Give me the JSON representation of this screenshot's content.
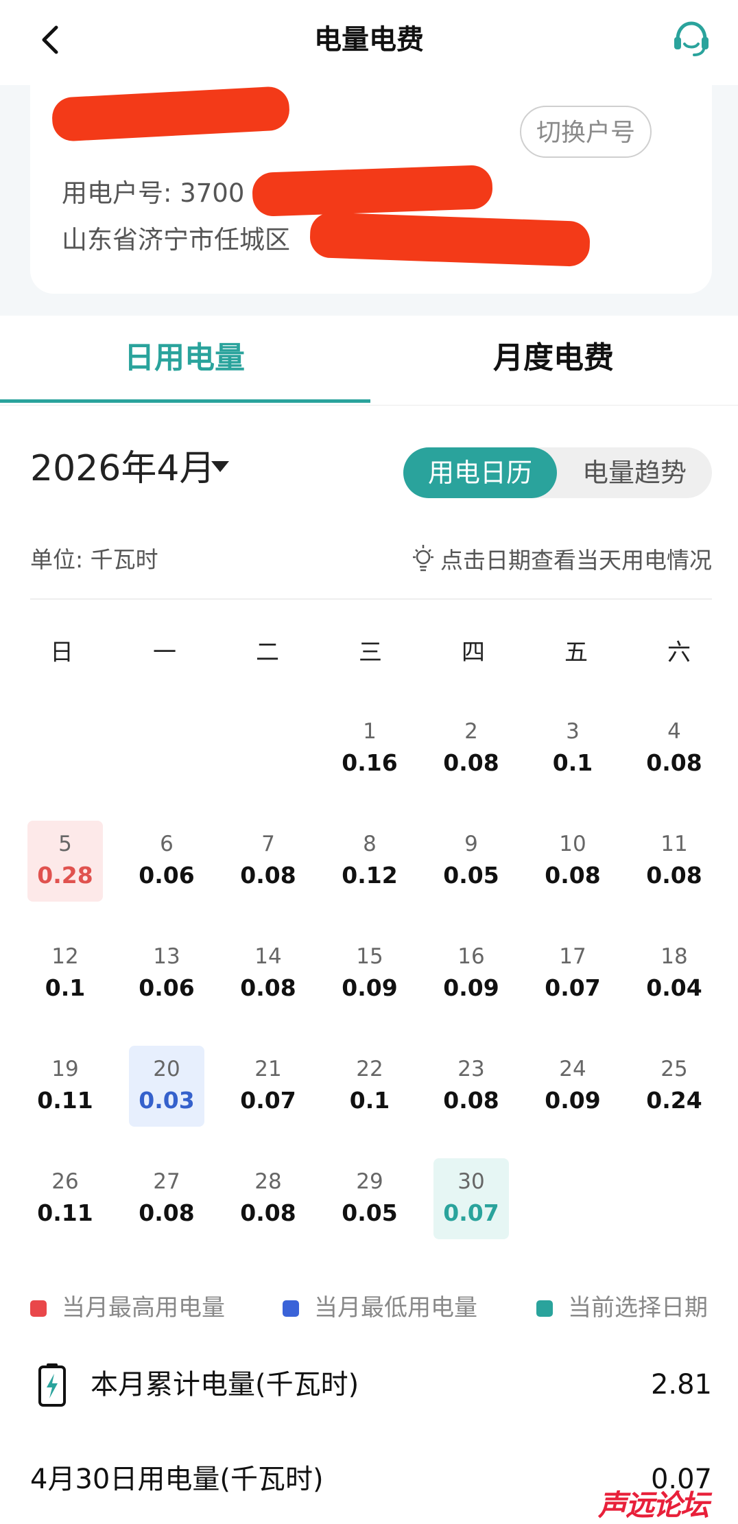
{
  "header": {
    "title": "电量电费",
    "back_icon": "chevron-left-icon",
    "service_icon": "headset-icon"
  },
  "account": {
    "switch_label": "切换户号",
    "account_prefix": "用电户号: 3700",
    "address_prefix": "山东省济宁市任城区"
  },
  "tabs": [
    {
      "label": "日用电量",
      "active": true
    },
    {
      "label": "月度电费",
      "active": false
    }
  ],
  "month": {
    "label": "2026年4月"
  },
  "view_toggle": {
    "active": "用电日历",
    "inactive": "电量趋势"
  },
  "unit_label": "单位: 千瓦时",
  "hint": "点击日期查看当天用电情况",
  "weekdays": [
    "日",
    "一",
    "二",
    "三",
    "四",
    "五",
    "六"
  ],
  "calendar": [
    {
      "day": "1",
      "value": "0.16"
    },
    {
      "day": "2",
      "value": "0.08"
    },
    {
      "day": "3",
      "value": "0.1"
    },
    {
      "day": "4",
      "value": "0.08"
    },
    {
      "day": "5",
      "value": "0.28",
      "state": "max"
    },
    {
      "day": "6",
      "value": "0.06"
    },
    {
      "day": "7",
      "value": "0.08"
    },
    {
      "day": "8",
      "value": "0.12"
    },
    {
      "day": "9",
      "value": "0.05"
    },
    {
      "day": "10",
      "value": "0.08"
    },
    {
      "day": "11",
      "value": "0.08"
    },
    {
      "day": "12",
      "value": "0.1"
    },
    {
      "day": "13",
      "value": "0.06"
    },
    {
      "day": "14",
      "value": "0.08"
    },
    {
      "day": "15",
      "value": "0.09"
    },
    {
      "day": "16",
      "value": "0.09"
    },
    {
      "day": "17",
      "value": "0.07"
    },
    {
      "day": "18",
      "value": "0.04"
    },
    {
      "day": "19",
      "value": "0.11"
    },
    {
      "day": "20",
      "value": "0.03",
      "state": "min"
    },
    {
      "day": "21",
      "value": "0.07"
    },
    {
      "day": "22",
      "value": "0.1"
    },
    {
      "day": "23",
      "value": "0.08"
    },
    {
      "day": "24",
      "value": "0.09"
    },
    {
      "day": "25",
      "value": "0.24"
    },
    {
      "day": "26",
      "value": "0.11"
    },
    {
      "day": "27",
      "value": "0.08"
    },
    {
      "day": "28",
      "value": "0.08"
    },
    {
      "day": "29",
      "value": "0.05"
    },
    {
      "day": "30",
      "value": "0.07",
      "state": "selected"
    }
  ],
  "legend": [
    {
      "label": "当月最高用电量",
      "color": "#e9474a"
    },
    {
      "label": "当月最低用电量",
      "color": "#3a63d8"
    },
    {
      "label": "当前选择日期",
      "color": "#2aa39c"
    }
  ],
  "summary": {
    "month_total_label": "本月累计电量(千瓦时)",
    "month_total_value": "2.81",
    "day_label": "4月30日用电量(千瓦时)",
    "day_value": "0.07"
  },
  "watermark": "声远论坛",
  "colors": {
    "accent": "#2aa39c",
    "max": "#e0524f",
    "min": "#3561cc"
  }
}
